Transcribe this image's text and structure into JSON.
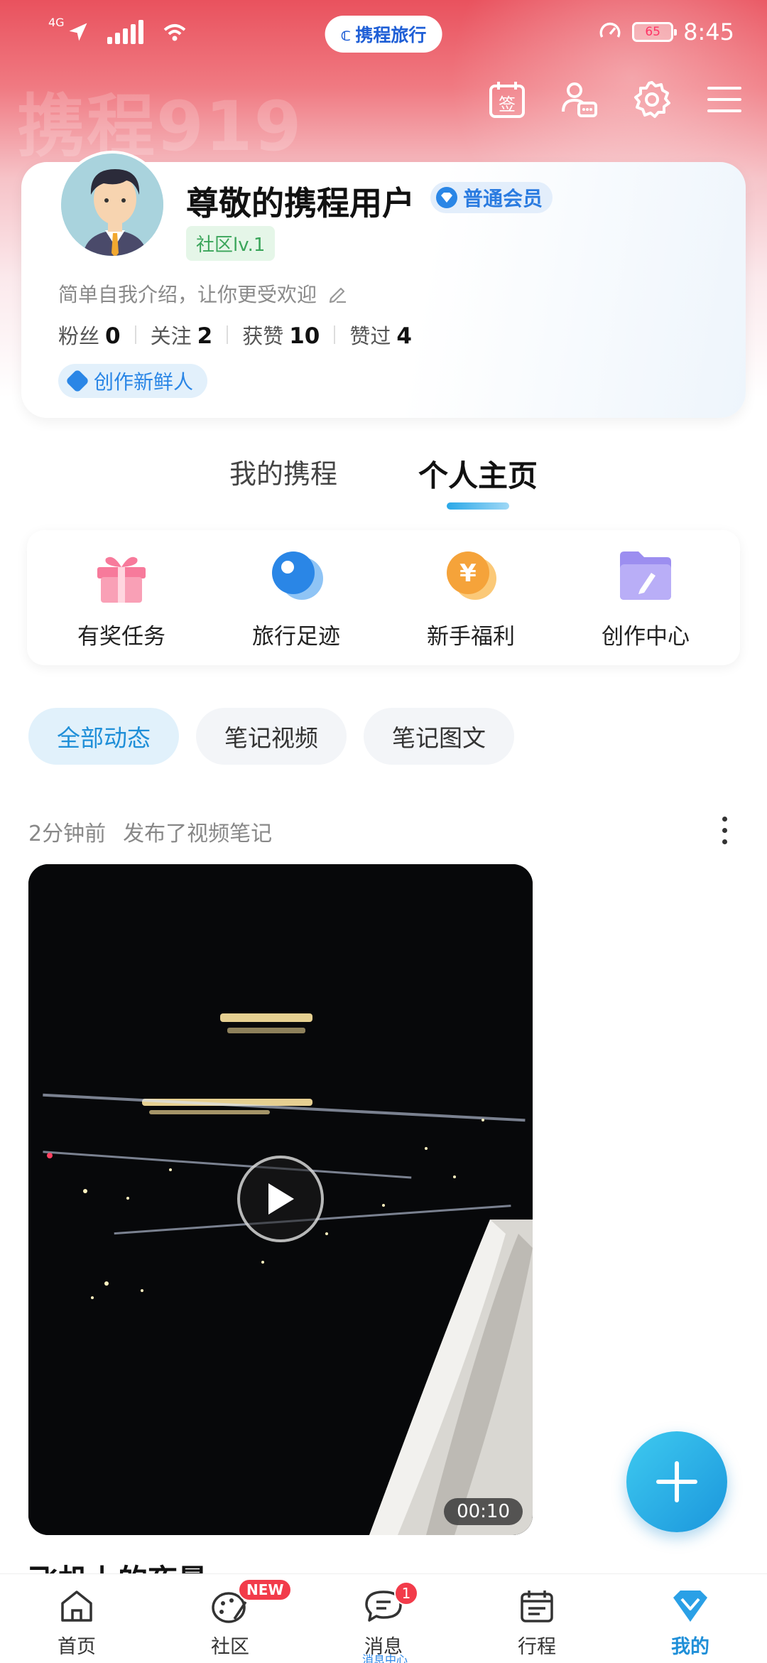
{
  "status_bar": {
    "network": "4G",
    "brand": "携程旅行",
    "battery": "65",
    "time": "8:45"
  },
  "hero": {
    "watermark": "携程919"
  },
  "top_actions": [
    "sign-in-icon",
    "user-card-icon",
    "gear-icon",
    "menu-icon"
  ],
  "top_actions_labels": {
    "sign": "签"
  },
  "profile": {
    "username": "尊敬的携程用户",
    "member": "普通会员",
    "level": "社区lv.1",
    "bio": "简单自我介绍，让你更受欢迎",
    "stats": [
      {
        "label": "粉丝",
        "value": "0"
      },
      {
        "label": "关注",
        "value": "2"
      },
      {
        "label": "获赞",
        "value": "10"
      },
      {
        "label": "赞过",
        "value": "4"
      }
    ],
    "creator_tag": "创作新鲜人"
  },
  "main_tabs": [
    {
      "label": "我的携程",
      "active": false
    },
    {
      "label": "个人主页",
      "active": true
    }
  ],
  "features": [
    {
      "label": "有奖任务",
      "icon": "gift-icon"
    },
    {
      "label": "旅行足迹",
      "icon": "location-pin-icon"
    },
    {
      "label": "新手福利",
      "icon": "coin-icon"
    },
    {
      "label": "创作中心",
      "icon": "folder-edit-icon"
    }
  ],
  "chips": [
    {
      "label": "全部动态",
      "active": true
    },
    {
      "label": "笔记视频",
      "active": false
    },
    {
      "label": "笔记图文",
      "active": false
    }
  ],
  "post": {
    "time": "2分钟前",
    "action": "发布了视频笔记",
    "duration": "00:10",
    "title": "飞机上的夜景"
  },
  "bottom_nav": [
    {
      "label": "首页",
      "icon": "home-icon",
      "badge": ""
    },
    {
      "label": "社区",
      "icon": "community-icon",
      "badge": "NEW"
    },
    {
      "label": "消息",
      "icon": "message-icon",
      "badge": "1"
    },
    {
      "label": "行程",
      "icon": "calendar-icon",
      "badge": ""
    },
    {
      "label": "我的",
      "icon": "my-diamond-icon",
      "badge": "",
      "active": true
    }
  ],
  "bottom_sub_label": "消息中心",
  "colors": {
    "accent": "#1f8fd8",
    "hero_red": "#e9525e",
    "badge_red": "#f23b4a"
  }
}
